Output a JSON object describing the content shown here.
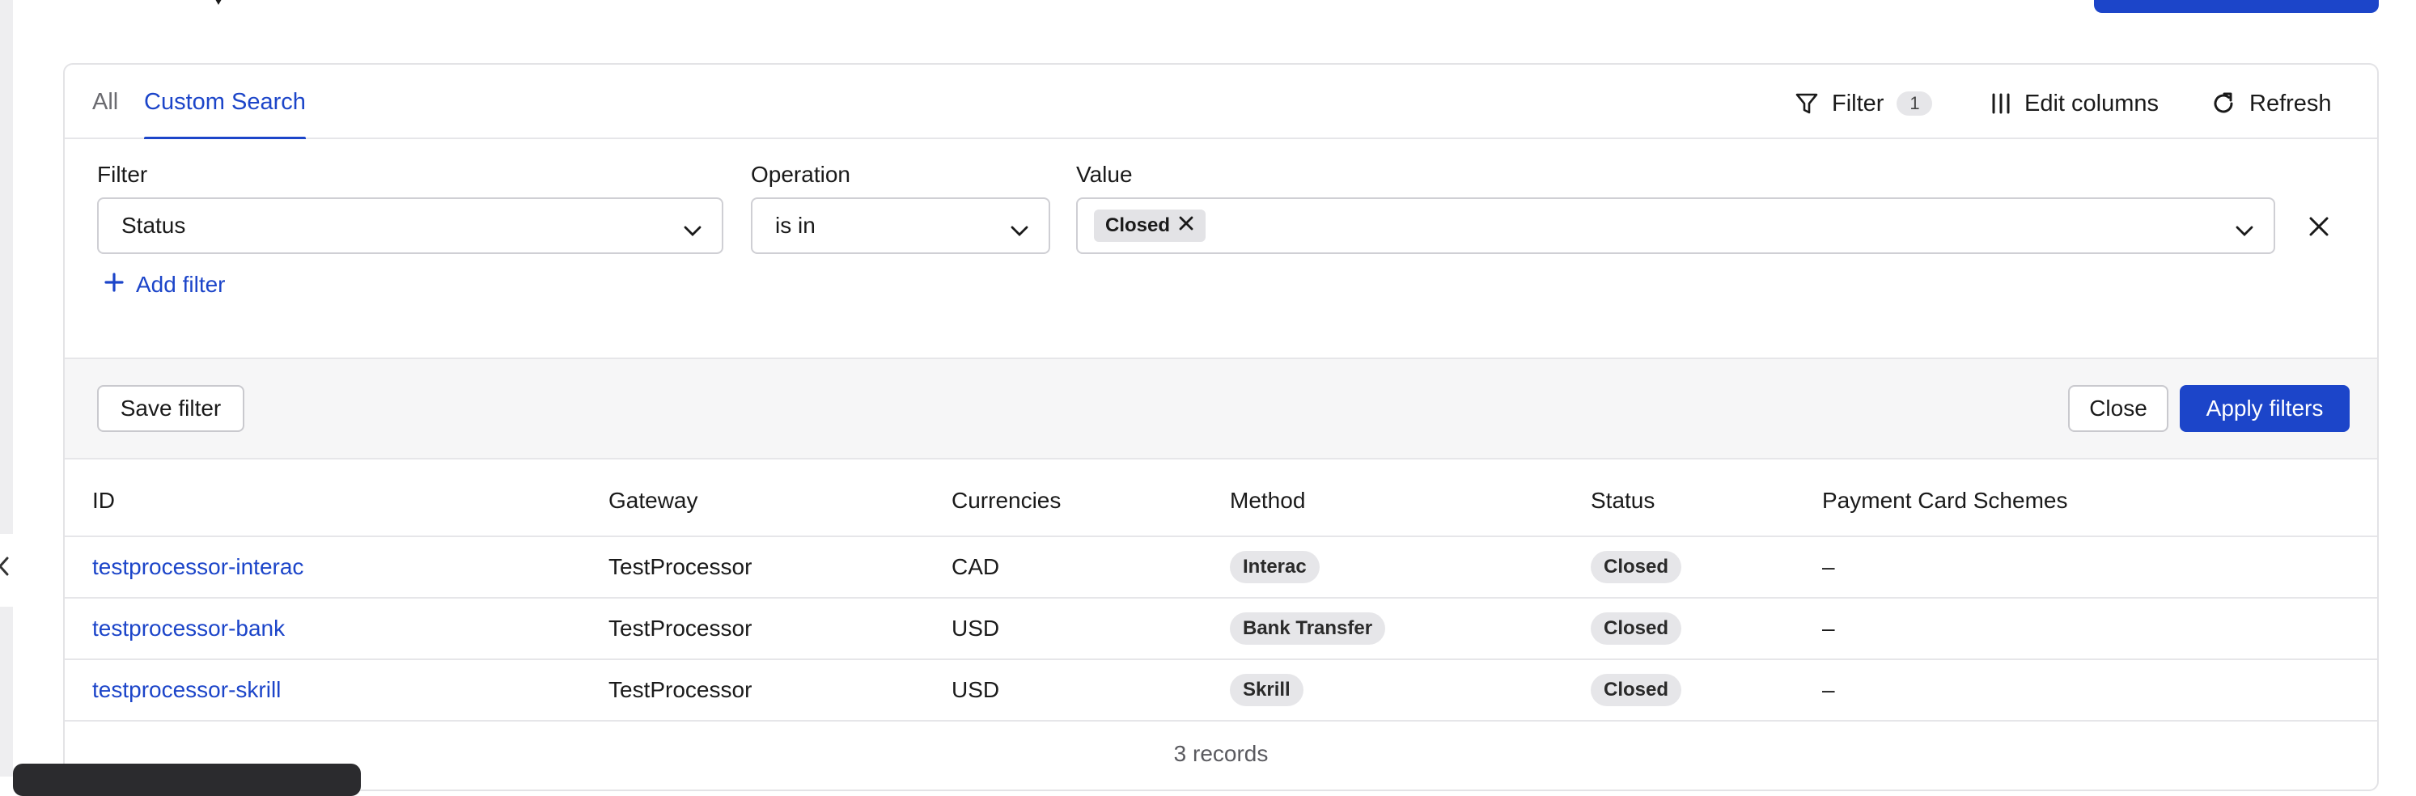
{
  "tabs": {
    "all": "All",
    "custom_search": "Custom Search"
  },
  "toolbar": {
    "filter_label": "Filter",
    "filter_count": "1",
    "edit_columns_label": "Edit columns",
    "refresh_label": "Refresh"
  },
  "filter_builder": {
    "filter_label": "Filter",
    "filter_value": "Status",
    "operation_label": "Operation",
    "operation_value": "is in",
    "value_label": "Value",
    "value_chip": "Closed",
    "add_filter_label": "Add filter"
  },
  "actions": {
    "save_filter": "Save filter",
    "close": "Close",
    "apply_filters": "Apply filters"
  },
  "table": {
    "columns": [
      "ID",
      "Gateway",
      "Currencies",
      "Method",
      "Status",
      "Payment Card Schemes"
    ],
    "rows": [
      {
        "id": "testprocessor-interac",
        "gateway": "TestProcessor",
        "currencies": "CAD",
        "method": "Interac",
        "status": "Closed",
        "schemes": "–"
      },
      {
        "id": "testprocessor-bank",
        "gateway": "TestProcessor",
        "currencies": "USD",
        "method": "Bank Transfer",
        "status": "Closed",
        "schemes": "–"
      },
      {
        "id": "testprocessor-skrill",
        "gateway": "TestProcessor",
        "currencies": "USD",
        "method": "Skrill",
        "status": "Closed",
        "schemes": "–"
      }
    ],
    "record_count": "3 records"
  },
  "colors": {
    "accent": "#1c45c9",
    "border": "#e6e6e9",
    "pill_bg": "#e6e6e9"
  },
  "icons": [
    "filter-icon",
    "columns-icon",
    "refresh-icon",
    "chevron-down-icon",
    "close-icon",
    "plus-icon",
    "chevron-left-icon"
  ]
}
